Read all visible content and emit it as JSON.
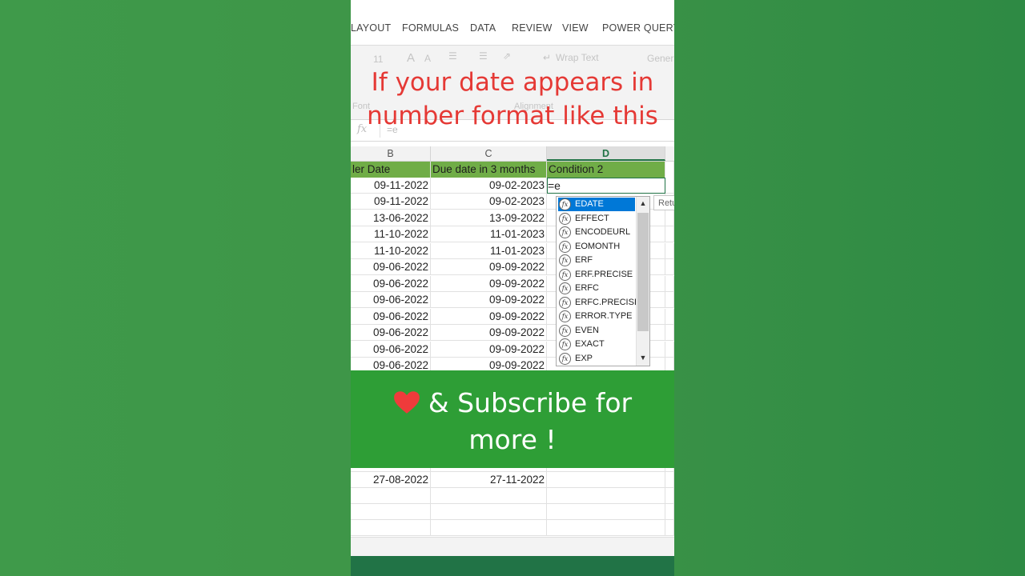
{
  "ribbon": {
    "tabs": [
      "LAYOUT",
      "FORMULAS",
      "DATA",
      "REVIEW",
      "VIEW",
      "POWER QUERY"
    ],
    "font_size": "11",
    "wrap_text": "Wrap Text",
    "number_format": "Genera",
    "group_font": "Font",
    "group_alignment": "Alignment"
  },
  "formula_bar": {
    "fx": "fx",
    "value": "=e"
  },
  "overlay": {
    "line1": "If your date appears in",
    "line2": "number format like this"
  },
  "columns": [
    "B",
    "C",
    "D"
  ],
  "header": {
    "b": "ler Date",
    "c": "Due date in 3 months",
    "d": "Condition 2"
  },
  "rows_top": [
    [
      "09-11-2022",
      "09-02-2023"
    ],
    [
      "09-11-2022",
      "09-02-2023"
    ],
    [
      "13-06-2022",
      "13-09-2022"
    ],
    [
      "11-10-2022",
      "11-01-2023"
    ],
    [
      "11-10-2022",
      "11-01-2023"
    ],
    [
      "09-06-2022",
      "09-09-2022"
    ],
    [
      "09-06-2022",
      "09-09-2022"
    ],
    [
      "09-06-2022",
      "09-09-2022"
    ],
    [
      "09-06-2022",
      "09-09-2022"
    ],
    [
      "09-06-2022",
      "09-09-2022"
    ],
    [
      "09-06-2022",
      "09-09-2022"
    ],
    [
      "09-06-2022",
      "09-09-2022"
    ]
  ],
  "row_bottom": [
    "27-08-2022",
    "27-11-2022"
  ],
  "active_cell_text": "=e",
  "tooltip": "Retu",
  "autocomplete": [
    "EDATE",
    "EFFECT",
    "ENCODEURL",
    "EOMONTH",
    "ERF",
    "ERF.PRECISE",
    "ERFC",
    "ERFC.PRECISE",
    "ERROR.TYPE",
    "EVEN",
    "EXACT",
    "EXP"
  ],
  "banner": {
    "line1": "& Subscribe for",
    "line2": "more !"
  },
  "colors": {
    "header_green": "#70ad47",
    "excel_green": "#217346",
    "banner_green": "#2e9e36",
    "title_red": "#e53935",
    "selection_blue": "#0078d7"
  }
}
